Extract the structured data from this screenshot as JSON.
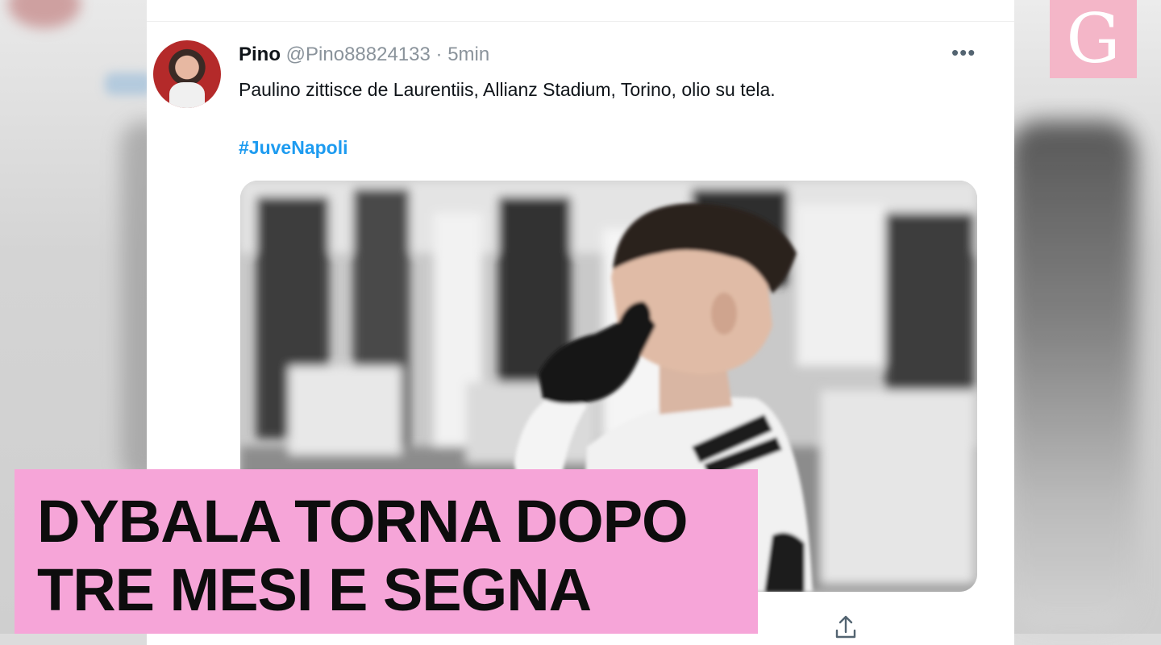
{
  "tweet": {
    "name": "Pino",
    "handle": "@Pino88824133",
    "separator": "·",
    "time": "5min",
    "text": "Paulino zittisce de Laurentiis, Allianz Stadium, Torino, olio su tela.",
    "hashtag": "#JuveNapoli",
    "more_icon": "more-horizontal-icon",
    "share_icon": "share-icon"
  },
  "headline": {
    "line1": "DYBALA TORNA DOPO",
    "line2": "TRE MESI E SEGNA"
  },
  "logo": {
    "letter": "G"
  },
  "colors": {
    "headline_bg": "#f6a5d8",
    "logo_bg": "#f4b6c8",
    "hashtag": "#1d9bf0",
    "meta": "#8a939b"
  }
}
